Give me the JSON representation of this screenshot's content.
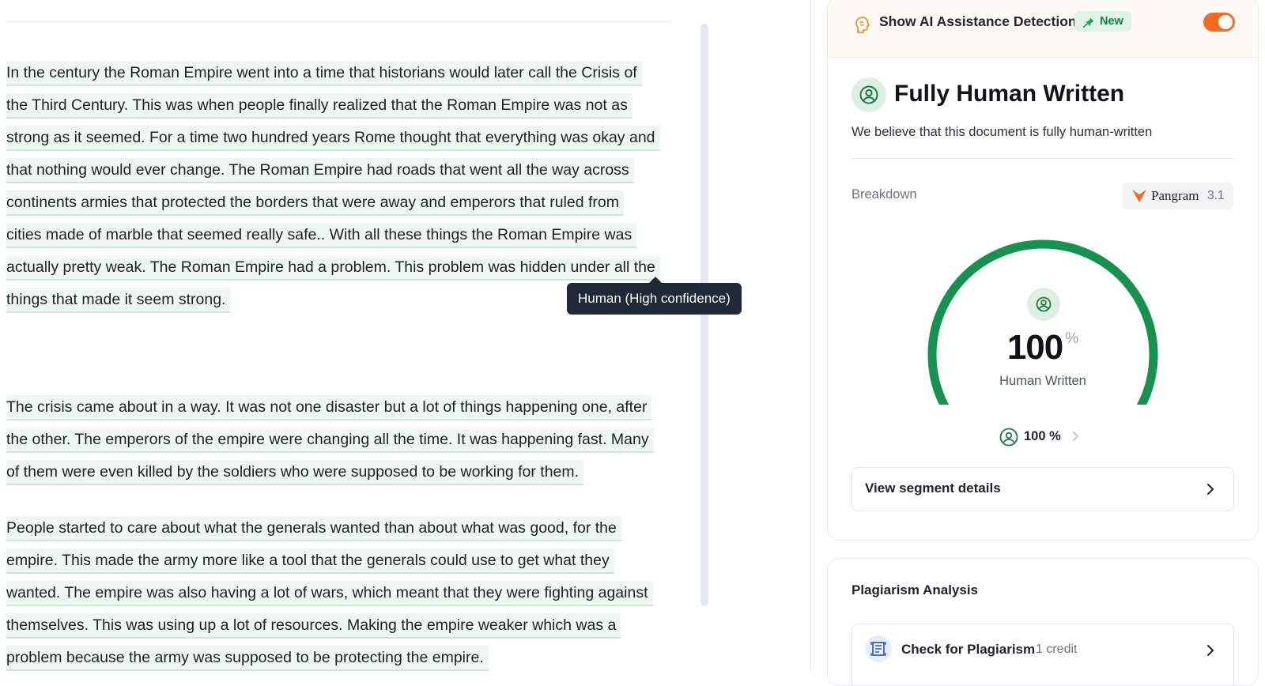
{
  "document": {
    "paragraphs": [
      {
        "lines": [
          "In the century the Roman Empire went into a time that historians would later call the Crisis of",
          "the Third Century. This was when people finally realized that the Roman Empire was not as",
          "strong as it seemed. For a time two hundred years Rome thought that everything was okay and",
          "that nothing would ever change. The Roman Empire had roads that went all the way across",
          "continents armies that protected the borders that were away and emperors that ruled from",
          "cities made of marble that seemed really safe.. With all these things the Roman Empire was",
          "actually pretty weak. The Roman Empire had a problem. This problem was hidden under all the",
          "things that made it seem strong."
        ]
      },
      {
        "lines": [
          "The crisis came about in a way. It was not one disaster but a lot of things happening one, after",
          "the other. The emperors of the empire were changing all the time. It was happening fast. Many",
          "of them were even killed by the soldiers who were supposed to be working for them."
        ]
      },
      {
        "lines": [
          "People started to care about what the generals wanted than about what was good, for the",
          "empire. This made the army more like a tool that the generals could use to get what they",
          "wanted. The empire was also having a lot of wars, which meant that they were fighting against",
          "themselves. This was using up a lot of resources. Making the empire weaker which was a",
          "problem because the army was supposed to be protecting the empire."
        ]
      }
    ],
    "tooltip": "Human (High confidence)",
    "highlight_color": "#eef7f1",
    "underline_color": "#cfe6d7"
  },
  "ai_detection": {
    "label": "Show AI Assistance Detection",
    "badge": "New",
    "toggle_on": true,
    "toggle_color": "#f36b21"
  },
  "result": {
    "title": "Fully Human Written",
    "description": "We believe that this document is fully human-written",
    "breakdown_label": "Breakdown",
    "model_name": "Pangram",
    "model_version": "3.1",
    "gauge_value": "100",
    "gauge_unit": "%",
    "gauge_caption": "Human Written",
    "gauge_fraction": 1.0,
    "gauge_color": "#15924f",
    "human_percent": "100 %",
    "segment_button": "View segment details"
  },
  "plagiarism": {
    "title": "Plagiarism Analysis",
    "button_label": "Check for Plagiarism",
    "credit": "1 credit"
  },
  "icons": {
    "ai_bar": "brain-icon",
    "badge": "pin-icon",
    "verdict": "user-circle-icon",
    "model": "pangram-logo-icon",
    "plagiarism": "document-scan-icon",
    "chevron": "chevron-right-icon"
  }
}
